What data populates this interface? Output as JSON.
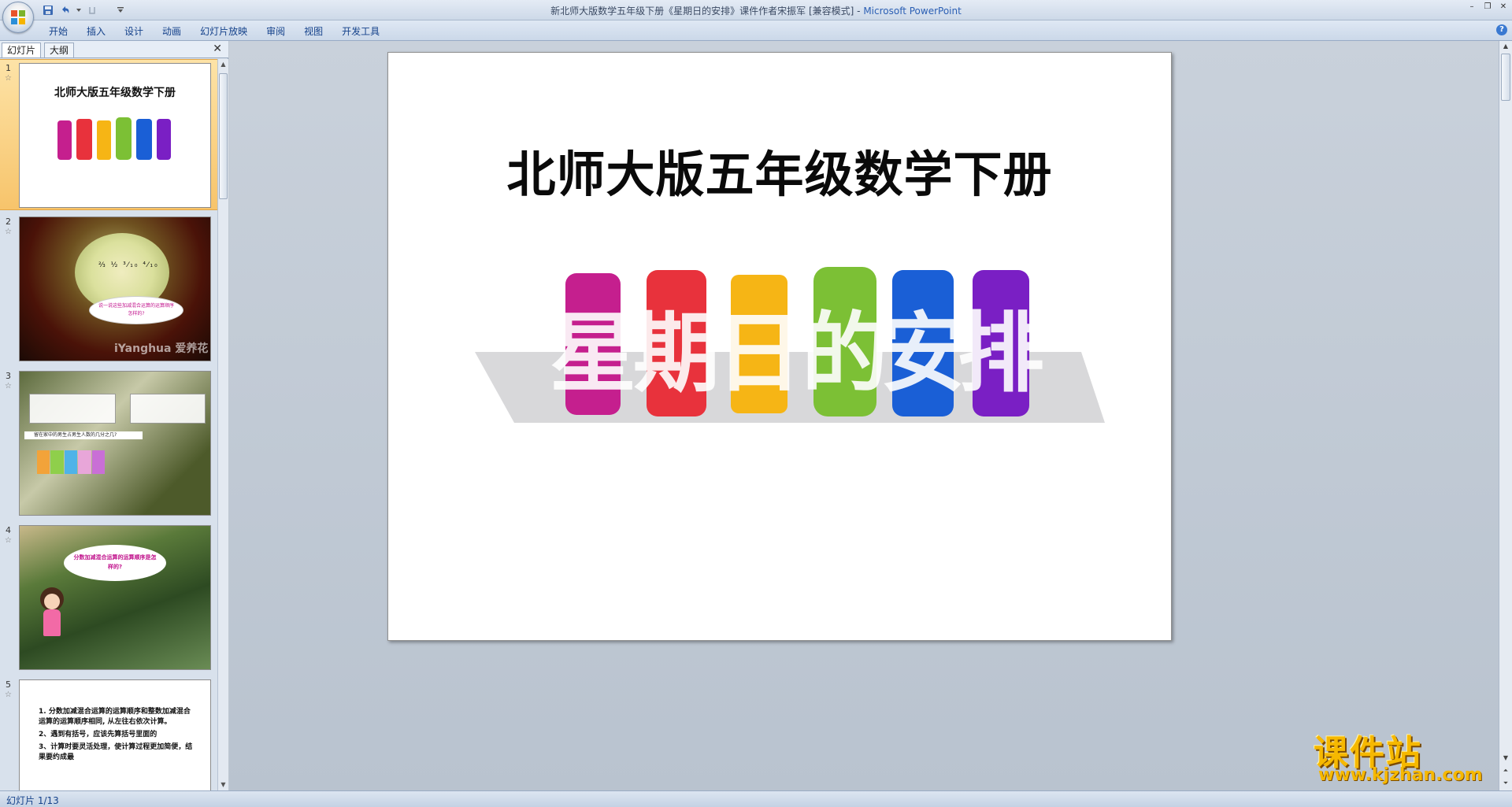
{
  "window": {
    "title": "新北师大版数学五年级下册《星期日的安排》课件作者宋振军 [兼容模式] - ",
    "app_name": "Microsoft PowerPoint"
  },
  "ribbon": {
    "tabs": [
      "开始",
      "插入",
      "设计",
      "动画",
      "幻灯片放映",
      "审阅",
      "视图",
      "开发工具"
    ]
  },
  "left_pane": {
    "tabs": [
      "幻灯片",
      "大纲"
    ],
    "slides": [
      {
        "number": "1",
        "title": "北师大版五年级数学下册"
      },
      {
        "number": "2",
        "bubble": "说一说这些加减混合运算的运算顺序怎样的?",
        "logo": "iYanghua 爱养花"
      },
      {
        "number": "3",
        "question": "留在家中的男生占男生人数的几分之几?"
      },
      {
        "number": "4",
        "bubble": "分数加减混合运算的运算顺序是怎样的?"
      },
      {
        "number": "5",
        "lines": [
          "1. 分数加减混合运算的运算顺序和整数加减混合运算的运算顺序相同, 从左往右依次计算。",
          "2、遇到有括号，应该先算括号里面的",
          "3、计算时要灵活处理，使计算过程更加简便，结果要约成最"
        ]
      }
    ]
  },
  "slide": {
    "title": "北师大版五年级数学下册",
    "art_text": "星期日的安排",
    "art_colors": [
      "#c51f8e",
      "#e8323c",
      "#f6b515",
      "#7cc035",
      "#1a5fd6",
      "#7a1fc4"
    ]
  },
  "watermark": {
    "cn": "课件站",
    "url": "www.kjzhan.com"
  },
  "status": {
    "slide_counter": "幻灯片 1/13"
  }
}
